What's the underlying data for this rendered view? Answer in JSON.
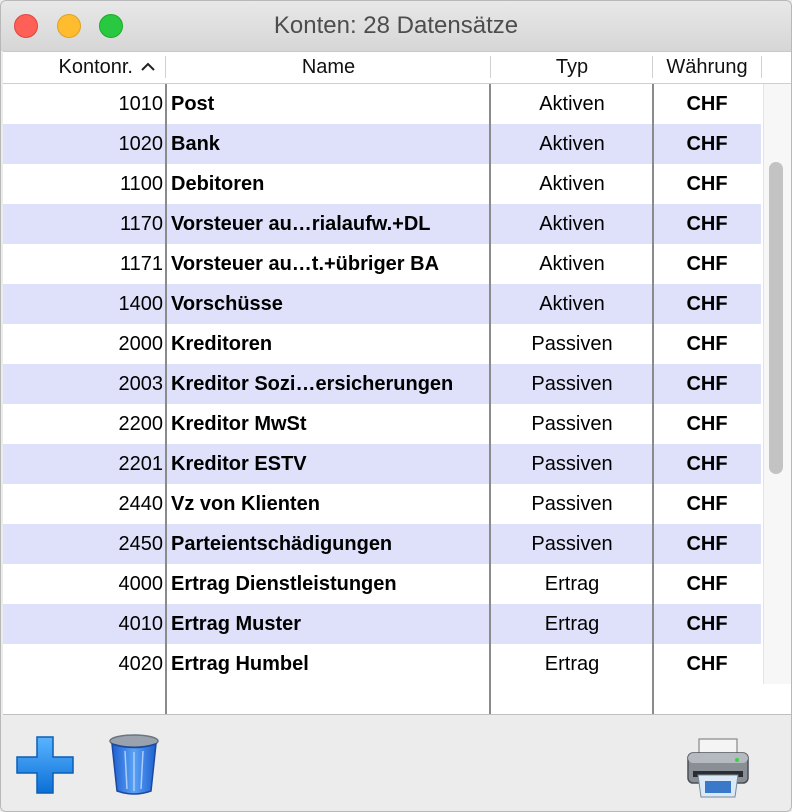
{
  "window": {
    "title": "Konten: 28 Datensätze"
  },
  "columns": {
    "nr": "Kontonr.",
    "name": "Name",
    "typ": "Typ",
    "currency": "Währung"
  },
  "rows": [
    {
      "nr": "1010",
      "name": "Post",
      "typ": "Aktiven",
      "currency": "CHF"
    },
    {
      "nr": "1020",
      "name": "Bank",
      "typ": "Aktiven",
      "currency": "CHF"
    },
    {
      "nr": "1100",
      "name": "Debitoren",
      "typ": "Aktiven",
      "currency": "CHF"
    },
    {
      "nr": "1170",
      "name": "Vorsteuer au…rialaufw.+DL",
      "typ": "Aktiven",
      "currency": "CHF"
    },
    {
      "nr": "1171",
      "name": "Vorsteuer au…t.+übriger BA",
      "typ": "Aktiven",
      "currency": "CHF"
    },
    {
      "nr": "1400",
      "name": "Vorschüsse",
      "typ": "Aktiven",
      "currency": "CHF"
    },
    {
      "nr": "2000",
      "name": "Kreditoren",
      "typ": "Passiven",
      "currency": "CHF"
    },
    {
      "nr": "2003",
      "name": "Kreditor Sozi…ersicherungen",
      "typ": "Passiven",
      "currency": "CHF"
    },
    {
      "nr": "2200",
      "name": "Kreditor MwSt",
      "typ": "Passiven",
      "currency": "CHF"
    },
    {
      "nr": "2201",
      "name": "Kreditor ESTV",
      "typ": "Passiven",
      "currency": "CHF"
    },
    {
      "nr": "2440",
      "name": "Vz von Klienten",
      "typ": "Passiven",
      "currency": "CHF"
    },
    {
      "nr": "2450",
      "name": "Parteientschädigungen",
      "typ": "Passiven",
      "currency": "CHF"
    },
    {
      "nr": "4000",
      "name": "Ertrag Dienstleistungen",
      "typ": "Ertrag",
      "currency": "CHF"
    },
    {
      "nr": "4010",
      "name": "Ertrag Muster",
      "typ": "Ertrag",
      "currency": "CHF"
    },
    {
      "nr": "4020",
      "name": "Ertrag Humbel",
      "typ": "Ertrag",
      "currency": "CHF"
    }
  ],
  "toolbar": {
    "add_icon": "plus-icon",
    "delete_icon": "trash-icon",
    "print_icon": "printer-icon"
  },
  "colors": {
    "alt_row": "#dfe1fa",
    "plus": "#1a86e8",
    "close": "#fe5f57",
    "minimize": "#febc2e",
    "zoom": "#28c840"
  }
}
